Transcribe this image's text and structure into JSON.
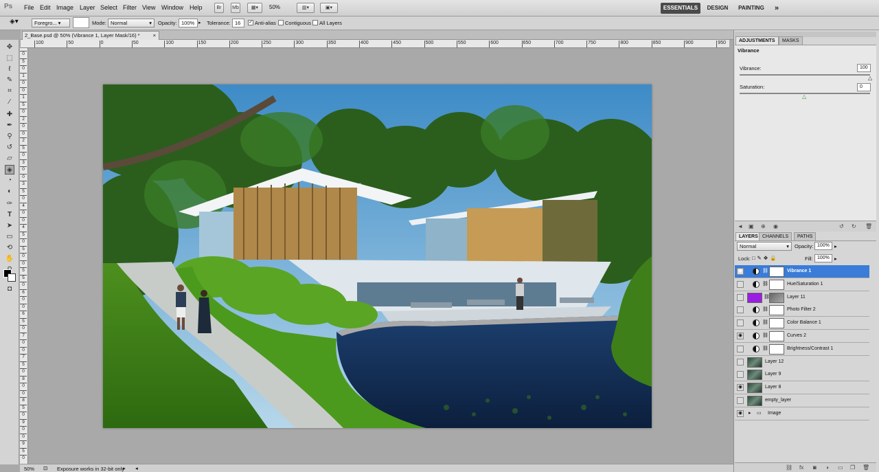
{
  "menubar": {
    "logo": "Ps",
    "items": [
      "File",
      "Edit",
      "Image",
      "Layer",
      "Select",
      "Filter",
      "View",
      "Window",
      "Help"
    ],
    "icons": [
      "Br",
      "Mb"
    ],
    "zoom": "50%",
    "workspaces": [
      "ESSENTIALS",
      "DESIGN",
      "PAINTING"
    ],
    "more": "»"
  },
  "options": {
    "fill_source": "Foregro...",
    "mode_label": "Mode:",
    "mode_value": "Normal",
    "opacity_label": "Opacity:",
    "opacity_value": "100%",
    "tolerance_label": "Tolerance:",
    "tolerance_value": "16",
    "antialias_label": "Anti-alias",
    "contiguous_label": "Contiguous",
    "all_layers_label": "All Layers"
  },
  "document": {
    "tab_title": "2_Base.psd @ 50% (Vibrance 1, Layer Mask/16) *",
    "close": "×"
  },
  "ruler": {
    "h_labels": [
      "100",
      "50",
      "0",
      "50",
      "100",
      "150",
      "200",
      "250",
      "300",
      "350",
      "400",
      "450",
      "500",
      "550",
      "600",
      "650",
      "700",
      "750",
      "800",
      "850",
      "900",
      "950"
    ],
    "v_labels": [
      "0",
      "5",
      "0",
      "1",
      "0",
      "0",
      "1",
      "5",
      "0",
      "2",
      "0",
      "0",
      "2",
      "5",
      "0",
      "3",
      "0",
      "0",
      "3",
      "5",
      "0",
      "4",
      "0",
      "0",
      "4",
      "5",
      "0",
      "5",
      "0",
      "0",
      "5",
      "5",
      "0",
      "6",
      "0",
      "0",
      "6",
      "5",
      "0",
      "7",
      "0",
      "0",
      "7",
      "5",
      "0",
      "8",
      "0",
      "0",
      "8",
      "5",
      "0",
      "9",
      "0",
      "0",
      "9",
      "5",
      "0"
    ]
  },
  "status": {
    "zoom": "50%",
    "message": "Exposure works in 32-bit only"
  },
  "adjustments": {
    "tabs": [
      "ADJUSTMENTS",
      "MASKS"
    ],
    "title": "Vibrance",
    "vibrance_label": "Vibrance:",
    "vibrance_value": "100",
    "vibrance_level": 1.0,
    "saturation_label": "Saturation:",
    "saturation_value": "0",
    "saturation_level": 0.5
  },
  "layers_panel": {
    "tabs": [
      "LAYERS",
      "CHANNELS",
      "PATHS"
    ],
    "blend_mode": "Normal",
    "opacity_label": "Opacity:",
    "opacity_value": "100%",
    "lock_label": "Lock:",
    "fill_label": "Fill:",
    "fill_value": "100%",
    "layers": [
      {
        "name": "Vibrance 1",
        "type": "adjustment",
        "visible": true,
        "selected": true
      },
      {
        "name": "Hue/Saturation 1",
        "type": "adjustment",
        "visible": false,
        "selected": false
      },
      {
        "name": "Layer 11",
        "type": "pixel",
        "visible": false,
        "selected": false,
        "color": "#9b1fe0"
      },
      {
        "name": "Photo Filter 2",
        "type": "adjustment",
        "visible": false,
        "selected": false
      },
      {
        "name": "Color Balance 1",
        "type": "adjustment",
        "visible": false,
        "selected": false
      },
      {
        "name": "Curves 2",
        "type": "adjustment",
        "visible": true,
        "selected": false
      },
      {
        "name": "Brightness/Contrast 1",
        "type": "adjustment",
        "visible": false,
        "selected": false
      },
      {
        "name": "Layer 12",
        "type": "pixel",
        "visible": false,
        "selected": false
      },
      {
        "name": "Layer 9",
        "type": "pixel",
        "visible": false,
        "selected": false
      },
      {
        "name": "Layer 8",
        "type": "pixel",
        "visible": true,
        "selected": false
      },
      {
        "name": "empty_layer",
        "type": "pixel",
        "visible": false,
        "selected": false
      },
      {
        "name": "Image",
        "type": "group",
        "visible": true,
        "selected": false
      }
    ]
  }
}
